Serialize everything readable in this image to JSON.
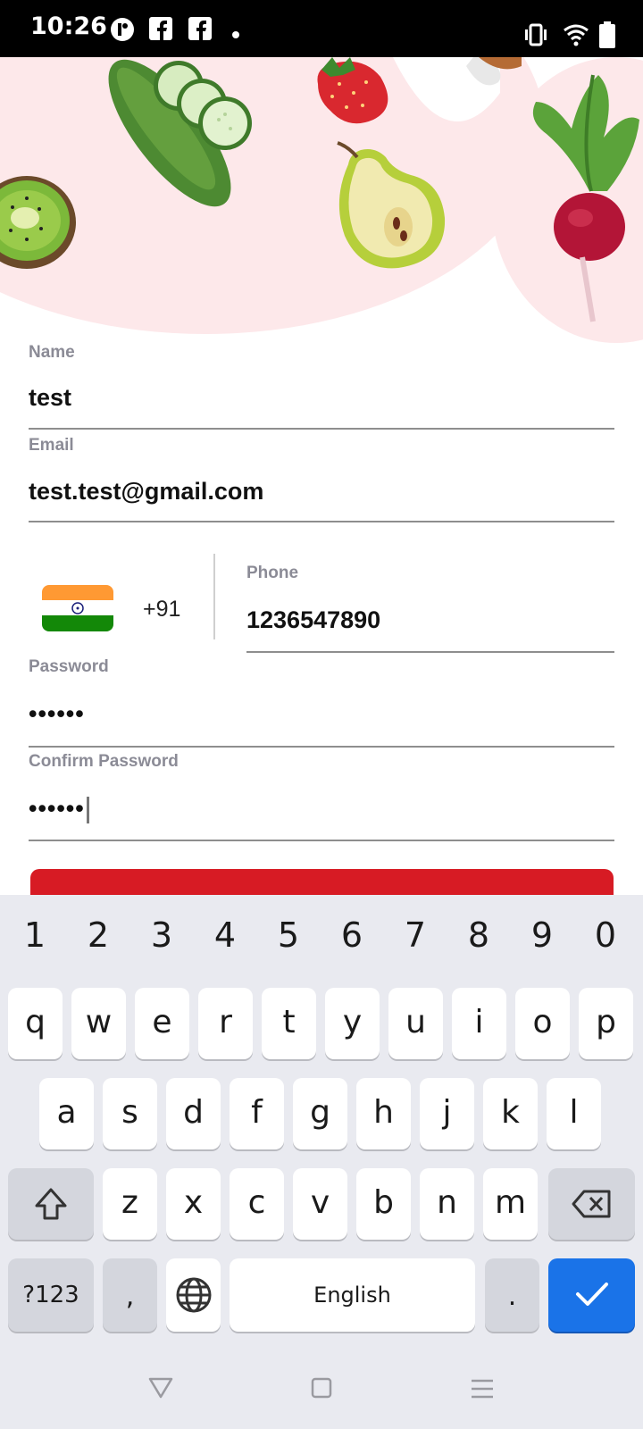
{
  "status_bar": {
    "time": "10:26"
  },
  "form": {
    "name": {
      "label": "Name",
      "value": "test"
    },
    "email": {
      "label": "Email",
      "value": "test.test@gmail.com"
    },
    "phone": {
      "country_code": "+91",
      "label": "Phone",
      "value": "1236547890"
    },
    "password": {
      "label": "Password",
      "value": "••••••"
    },
    "confirm_password": {
      "label": "Confirm Password",
      "value": "••••••"
    }
  },
  "keyboard": {
    "digits": [
      "1",
      "2",
      "3",
      "4",
      "5",
      "6",
      "7",
      "8",
      "9",
      "0"
    ],
    "row1": [
      "q",
      "w",
      "e",
      "r",
      "t",
      "y",
      "u",
      "i",
      "o",
      "p"
    ],
    "row2": [
      "a",
      "s",
      "d",
      "f",
      "g",
      "h",
      "j",
      "k",
      "l"
    ],
    "row3": [
      "z",
      "x",
      "c",
      "v",
      "b",
      "n",
      "m"
    ],
    "symbols_label": "?123",
    "comma": ",",
    "space_label": "English",
    "period": "."
  },
  "colors": {
    "accent_red": "#d71b24",
    "keyboard_enter": "#1a73e8",
    "hero_pink": "#fde8ea"
  }
}
